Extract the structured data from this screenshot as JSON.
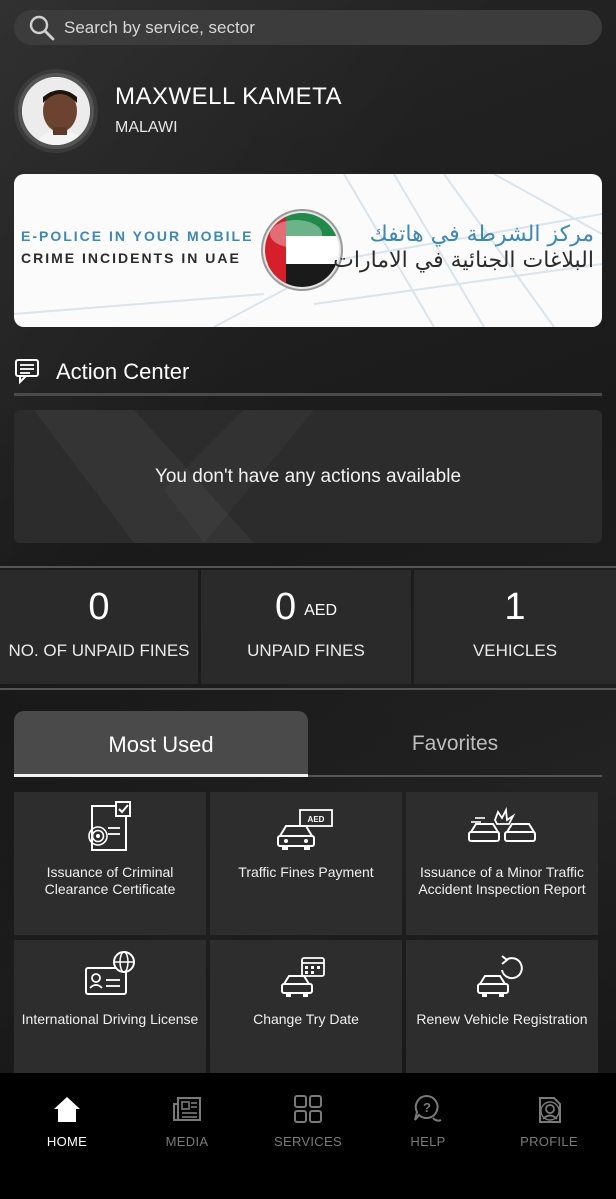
{
  "search": {
    "placeholder": "Search by service, sector",
    "icon": "search-icon"
  },
  "profile": {
    "name": "MAXWELL KAMETA",
    "country": "MALAWI"
  },
  "banner": {
    "line1": "E-POLICE IN YOUR MOBILE",
    "line2": "CRIME INCIDENTS IN UAE",
    "arabic1": "مركز الشرطة في هاتفك",
    "arabic2": "البلاغات الجنائية في الامارات"
  },
  "action_center": {
    "title": "Action Center",
    "empty_message": "You don't have any actions available"
  },
  "stats": [
    {
      "value": "0",
      "unit": "",
      "label": "NO. OF UNPAID FINES"
    },
    {
      "value": "0",
      "unit": "AED",
      "label": "UNPAID FINES"
    },
    {
      "value": "1",
      "unit": "",
      "label": "VEHICLES"
    }
  ],
  "tabs": [
    {
      "label": "Most Used",
      "active": true
    },
    {
      "label": "Favorites",
      "active": false
    }
  ],
  "services": [
    {
      "label": "Issuance of Criminal Clearance Certificate",
      "icon": "certificate-fingerprint-icon"
    },
    {
      "label": "Traffic Fines Payment",
      "icon": "car-fine-payment-icon"
    },
    {
      "label": "Issuance of a Minor Traffic Accident Inspection Report",
      "icon": "car-accident-icon"
    },
    {
      "label": "International Driving License",
      "icon": "id-card-globe-icon"
    },
    {
      "label": "Change Try Date",
      "icon": "car-calendar-icon"
    },
    {
      "label": "Renew Vehicle Registration",
      "icon": "car-renew-icon"
    }
  ],
  "nav": [
    {
      "label": "HOME",
      "icon": "home-icon",
      "active": true
    },
    {
      "label": "MEDIA",
      "icon": "newspaper-icon",
      "active": false
    },
    {
      "label": "SERVICES",
      "icon": "grid-icon",
      "active": false
    },
    {
      "label": "HELP",
      "icon": "help-chat-icon",
      "active": false
    },
    {
      "label": "PROFILE",
      "icon": "profile-doc-icon",
      "active": false
    }
  ],
  "colors": {
    "accent_blue": "#3c89b8",
    "card_bg": "#2d2d2d",
    "nav_bg": "#000000"
  }
}
